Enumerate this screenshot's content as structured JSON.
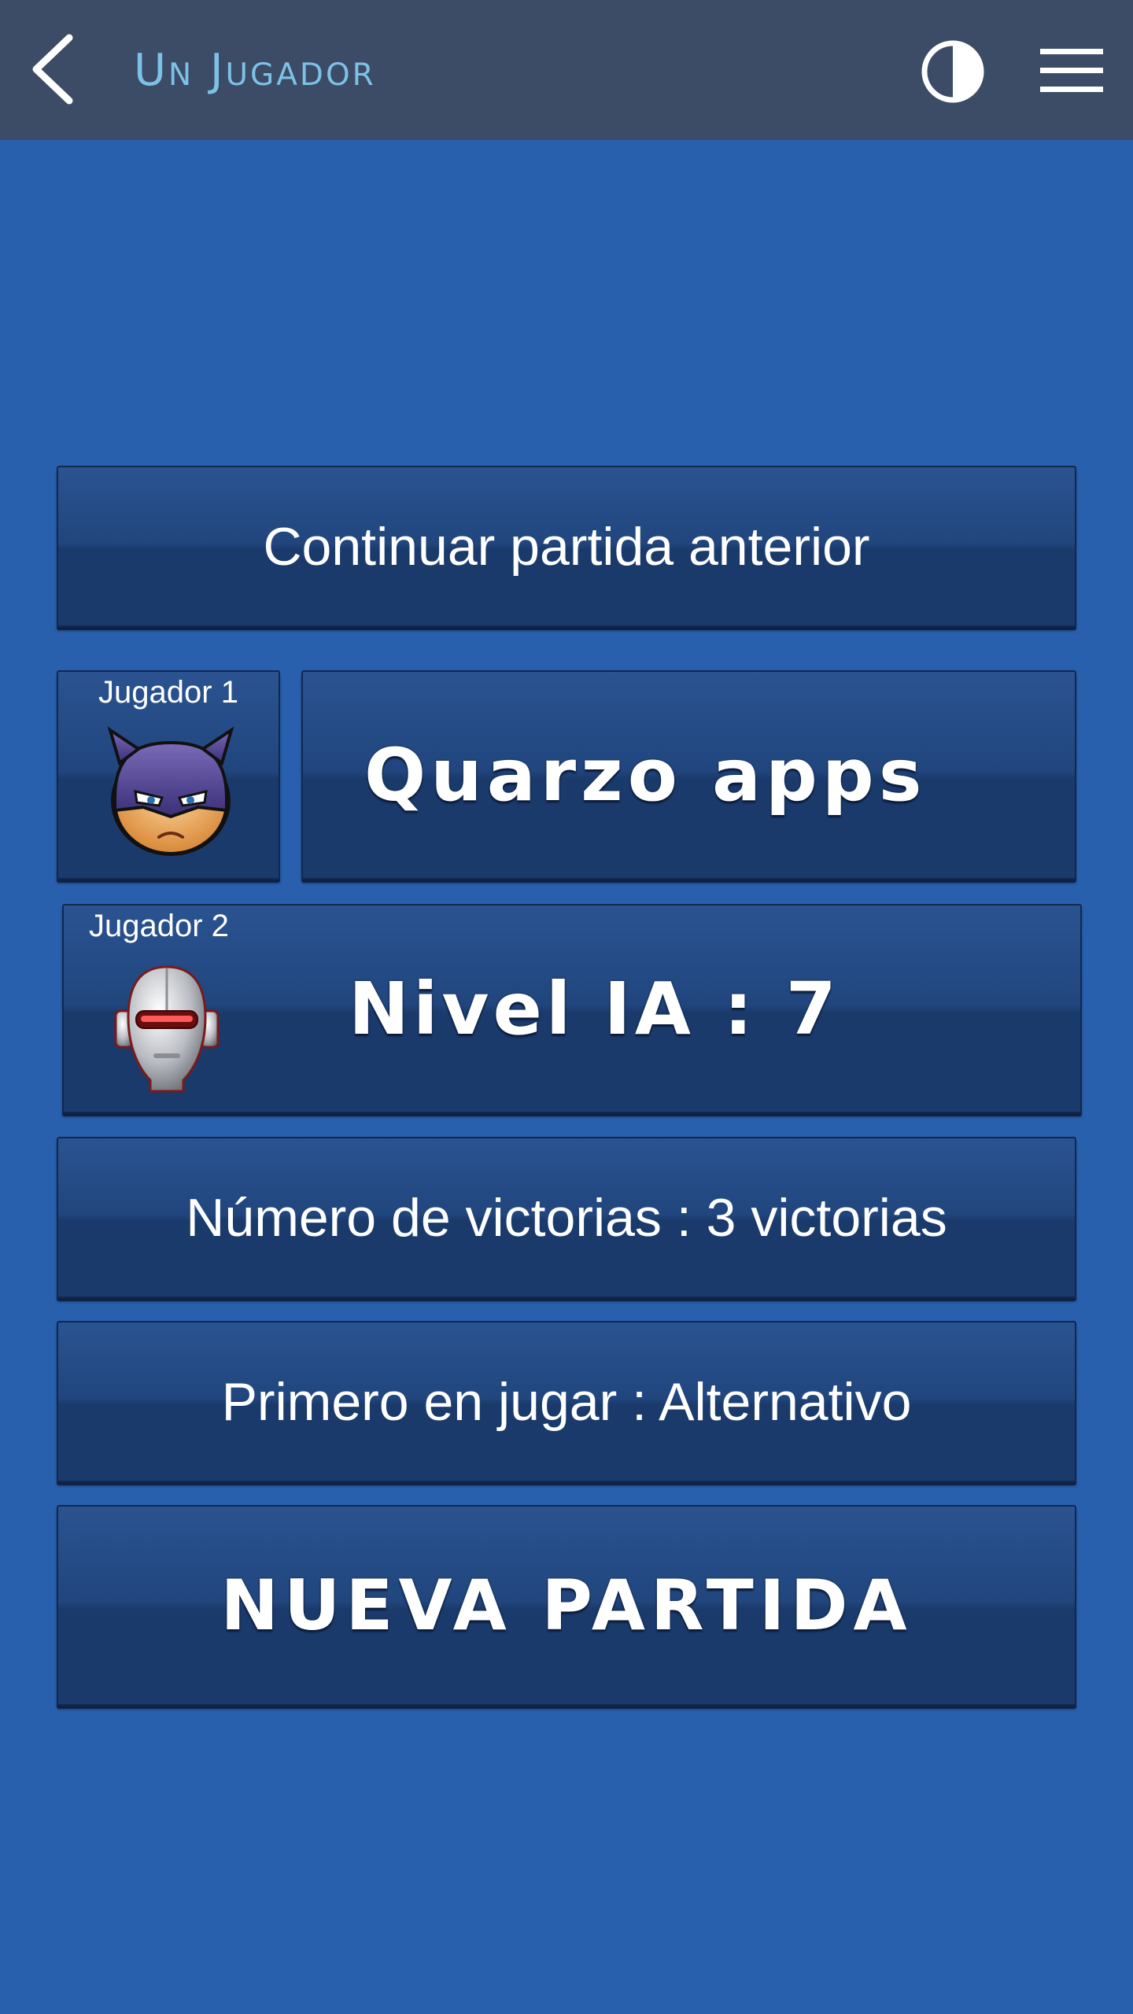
{
  "header": {
    "title": "Un Jugador",
    "back_icon": "chevron-left-icon",
    "contrast_icon": "contrast-icon",
    "menu_icon": "hamburger-menu-icon",
    "bar_color": "#3c4b66",
    "title_color": "#7cc2e6"
  },
  "colors": {
    "background": "#2860ae",
    "panel": "#21467e"
  },
  "continue_button": {
    "label": "Continuar partida anterior"
  },
  "player1": {
    "label": "Jugador 1",
    "name": "Quarzo apps",
    "avatar_icon": "masked-hero-avatar-icon"
  },
  "player2": {
    "label": "Jugador 2",
    "level_text": "Nivel IA : 7",
    "avatar_icon": "robot-head-avatar-icon"
  },
  "wins_option": {
    "label": "Número de victorias : 3 victorias"
  },
  "first_player_option": {
    "label": "Primero en jugar : Alternativo"
  },
  "new_game_button": {
    "label": "NUEVA PARTIDA"
  }
}
